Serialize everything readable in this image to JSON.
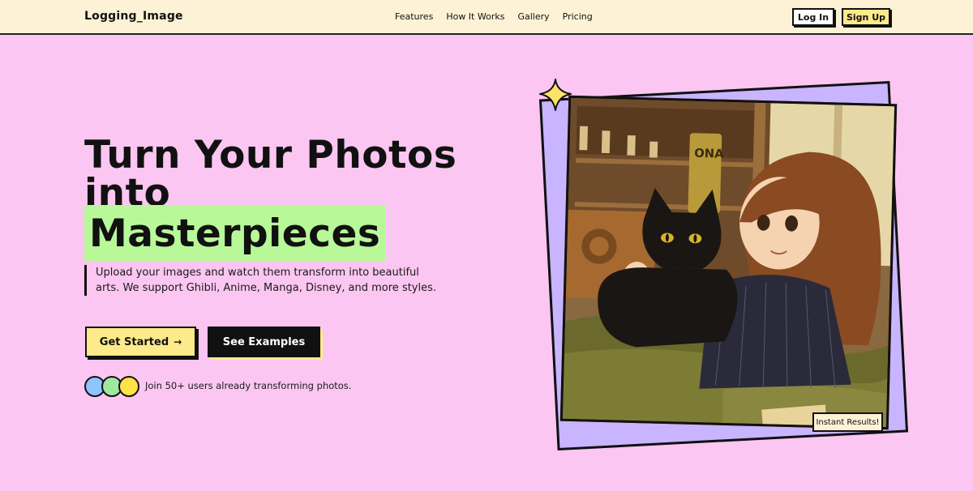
{
  "nav": {
    "brand": "Logging_Image",
    "links": [
      "Features",
      "How It Works",
      "Gallery",
      "Pricing"
    ],
    "login_label": "Log In",
    "signup_label": "Sign Up"
  },
  "hero": {
    "title_line1": "Turn Your Photos",
    "title_line2": "into",
    "title_highlight": "Masterpieces",
    "description": "Upload your images and watch them transform into beautiful arts. We support Ghibli, Anime, Manga, Disney, and more styles.",
    "cta_primary": "Get Started",
    "cta_primary_icon": "→",
    "cta_secondary": "See Examples",
    "social_proof": "Join 50+ users already transforming photos."
  },
  "illustration": {
    "badge": "Instant Results!",
    "shelf_label": "ONA"
  },
  "colors": {
    "page_bg": "#fbc6f1",
    "nav_bg": "#fdf2d6",
    "highlight": "#b8f899",
    "yellow": "#fdea8b",
    "purple": "#c9b4ff",
    "avatar_colors": [
      "#8fc4ff",
      "#9fe8a0",
      "#ffe14a"
    ]
  },
  "icons": [
    "arrow-right-icon",
    "sparkle-icon"
  ]
}
